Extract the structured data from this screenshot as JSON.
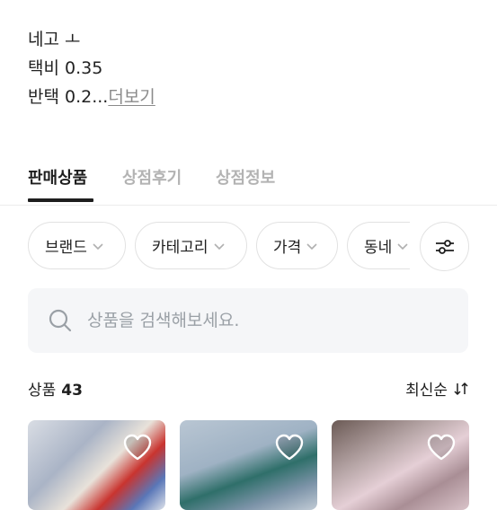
{
  "description": {
    "line1": "네고 ㅗ",
    "line2": "택비 0.35",
    "line3_text": "반택 0.2...",
    "more_label": "더보기"
  },
  "tabs": [
    {
      "label": "판매상품",
      "active": true
    },
    {
      "label": "상점후기",
      "active": false
    },
    {
      "label": "상점정보",
      "active": false
    }
  ],
  "filters": [
    {
      "label": "브랜드"
    },
    {
      "label": "카테고리"
    },
    {
      "label": "가격"
    },
    {
      "label": "동네"
    }
  ],
  "filter_button_icon": "sliders-icon",
  "search": {
    "placeholder": "상품을 검색해보세요."
  },
  "products_header": {
    "label": "상품",
    "count": "43",
    "sort_label": "최신순"
  },
  "colors": {
    "accent": "#1e1e1e",
    "muted": "#b3b3b3",
    "search_bg": "#f5f6f8"
  },
  "cards": [
    {
      "icon": "heart-icon",
      "liked": false
    },
    {
      "icon": "heart-icon",
      "liked": false
    },
    {
      "icon": "heart-icon",
      "liked": false
    }
  ]
}
